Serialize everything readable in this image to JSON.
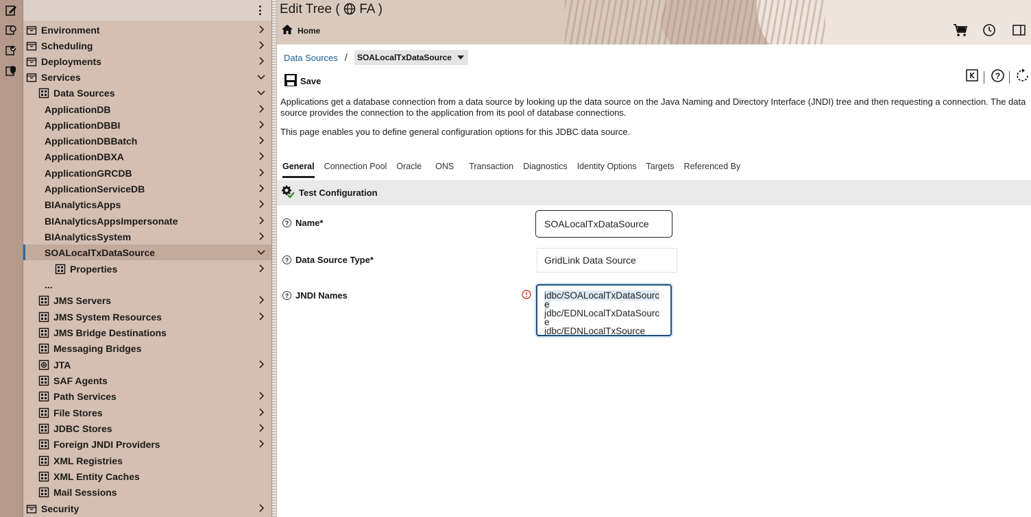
{
  "nav": {
    "items": [
      {
        "label": "Environment",
        "icon": "package-icon",
        "indent": 0,
        "chevron": "right"
      },
      {
        "label": "Scheduling",
        "icon": "package-icon",
        "indent": 0,
        "chevron": "right"
      },
      {
        "label": "Deployments",
        "icon": "package-icon",
        "indent": 0,
        "chevron": "right"
      },
      {
        "label": "Services",
        "icon": "package-icon",
        "indent": 0,
        "chevron": "down"
      },
      {
        "label": "Data Sources",
        "icon": "grid-icon",
        "indent": 1,
        "chevron": "down"
      },
      {
        "label": "ApplicationDB",
        "icon": "",
        "indent": 2,
        "chevron": "right"
      },
      {
        "label": "ApplicationDBBI",
        "icon": "",
        "indent": 2,
        "chevron": "right"
      },
      {
        "label": "ApplicationDBBatch",
        "icon": "",
        "indent": 2,
        "chevron": "right"
      },
      {
        "label": "ApplicationDBXA",
        "icon": "",
        "indent": 2,
        "chevron": "right"
      },
      {
        "label": "ApplicationGRCDB",
        "icon": "",
        "indent": 2,
        "chevron": "right"
      },
      {
        "label": "ApplicationServiceDB",
        "icon": "",
        "indent": 2,
        "chevron": "right"
      },
      {
        "label": "BIAnalyticsApps",
        "icon": "",
        "indent": 2,
        "chevron": "right"
      },
      {
        "label": "BIAnalyticsAppsImpersonate",
        "icon": "",
        "indent": 2,
        "chevron": "right"
      },
      {
        "label": "BIAnalyticsSystem",
        "icon": "",
        "indent": 2,
        "chevron": "right"
      },
      {
        "label": "SOALocalTxDataSource",
        "icon": "",
        "indent": 2,
        "chevron": "down",
        "selected": true
      },
      {
        "label": "Properties",
        "icon": "grid-icon",
        "indent": 3,
        "chevron": "right"
      },
      {
        "label": "...",
        "icon": "",
        "indent": 2,
        "chevron": ""
      },
      {
        "label": "JMS Servers",
        "icon": "grid-icon",
        "indent": 1,
        "chevron": "right"
      },
      {
        "label": "JMS System Resources",
        "icon": "grid-icon",
        "indent": 1,
        "chevron": "right"
      },
      {
        "label": "JMS Bridge Destinations",
        "icon": "grid-icon",
        "indent": 1,
        "chevron": ""
      },
      {
        "label": "Messaging Bridges",
        "icon": "grid-icon",
        "indent": 1,
        "chevron": ""
      },
      {
        "label": "JTA",
        "icon": "circle-plus-icon",
        "indent": 1,
        "chevron": "right"
      },
      {
        "label": "SAF Agents",
        "icon": "grid-icon",
        "indent": 1,
        "chevron": ""
      },
      {
        "label": "Path Services",
        "icon": "grid-icon",
        "indent": 1,
        "chevron": "right"
      },
      {
        "label": "File Stores",
        "icon": "grid-icon",
        "indent": 1,
        "chevron": "right"
      },
      {
        "label": "JDBC Stores",
        "icon": "grid-icon",
        "indent": 1,
        "chevron": "right"
      },
      {
        "label": "Foreign JNDI Providers",
        "icon": "grid-icon",
        "indent": 1,
        "chevron": "right"
      },
      {
        "label": "XML Registries",
        "icon": "grid-icon",
        "indent": 1,
        "chevron": ""
      },
      {
        "label": "XML Entity Caches",
        "icon": "grid-icon",
        "indent": 1,
        "chevron": ""
      },
      {
        "label": "Mail Sessions",
        "icon": "grid-icon",
        "indent": 1,
        "chevron": ""
      },
      {
        "label": "Security",
        "icon": "package-icon",
        "indent": 0,
        "chevron": "right"
      }
    ]
  },
  "header": {
    "title": "Edit Tree (",
    "title_suffix": "FA )",
    "home_label": "Home"
  },
  "breadcrumb": {
    "link": "Data Sources",
    "separator": "/",
    "current": "SOALocalTxDataSource"
  },
  "toolbar": {
    "save_label": "Save"
  },
  "description": {
    "para1": "Applications get a database connection from a data source by looking up the data source on the Java Naming and Directory Interface (JNDI) tree and then requesting a connection. The data source provides the connection to the application from its pool of database connections.",
    "para2": "This page enables you to define general configuration options for this JDBC data source."
  },
  "tabs": [
    {
      "label": "General",
      "active": true
    },
    {
      "label": "Connection Pool"
    },
    {
      "label": "Oracle"
    },
    {
      "label": "ONS"
    },
    {
      "label": "Transaction"
    },
    {
      "label": "Diagnostics"
    },
    {
      "label": "Identity Options"
    },
    {
      "label": "Targets"
    },
    {
      "label": "Referenced By"
    }
  ],
  "test_config": {
    "label": "Test Configuration"
  },
  "form": {
    "name_label": "Name*",
    "name_value": "SOALocalTxDataSource",
    "type_label": "Data Source Type*",
    "type_value": "GridLink Data Source",
    "jndi_label": "JNDI Names",
    "jndi_lines": [
      "jdbc/SOALocalTxDataSourc",
      "e",
      "jdbc/EDNLocalTxDataSourc",
      "e",
      "jdbc/EDNLocalTxSource"
    ]
  },
  "colors": {
    "nav_bg": "#d5bfb3",
    "selected_accent": "#2c6a9e",
    "link": "#1a5c94"
  }
}
